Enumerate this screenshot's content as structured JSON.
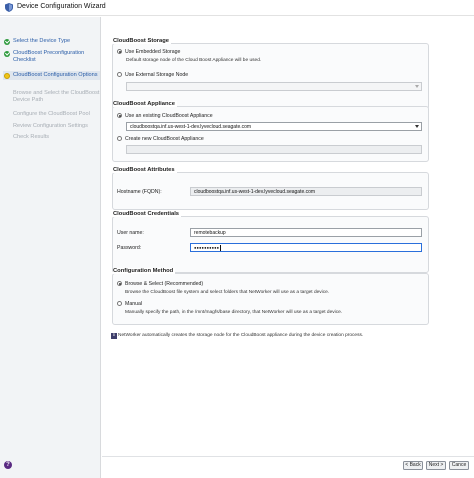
{
  "window": {
    "title": "Device Configuration Wizard"
  },
  "steps": [
    {
      "label": "Select the Device Type",
      "state": "done"
    },
    {
      "label": "CloudBoost Preconfiguration Checklist",
      "state": "done"
    },
    {
      "label": "CloudBoost Configuration Options",
      "state": "current"
    },
    {
      "label": "Browse and Select the CloudBoost Device Path",
      "state": "pending"
    },
    {
      "label": "Configure the CloudBoost Pool",
      "state": "pending"
    },
    {
      "label": "Review Configuration Settings",
      "state": "pending"
    },
    {
      "label": "Check Results",
      "state": "pending"
    }
  ],
  "storage": {
    "title": "CloudBoost Storage",
    "embedded_label": "Use Embedded Storage",
    "embedded_desc": "Default storage node of the Cloud Boost Appliance will be used.",
    "external_label": "Use External Storage Node",
    "external_value": ""
  },
  "appliance": {
    "title": "CloudBoost Appliance",
    "existing_label": "Use an existing CloudBoost Appliance",
    "existing_value": "cloudboostqa.inf.us-west-1-dev.lyvecloud.seagate.com",
    "new_label": "Create new CloudBoost Appliance",
    "new_value": ""
  },
  "attributes": {
    "title": "CloudBoost Attributes",
    "hostname_label": "Hostname (FQDN):",
    "hostname_value": "cloudboostqa.inf.us-west-1-dev.lyvecloud.seagate.com"
  },
  "credentials": {
    "title": "CloudBoost Credentials",
    "username_label": "User name:",
    "username_value": "remotebackup",
    "password_label": "Password:",
    "password_value": "●●●●●●●●●●"
  },
  "method": {
    "title": "Configuration Method",
    "browse_label": "Browse & Select (Recommended)",
    "browse_desc": "Browse the CloudBoost file system and select folders that NetWorker will use as a target device.",
    "manual_label": "Manual",
    "manual_desc": "Manually specify the path, in the /mnt/magfs/base directory, that NetWorker will use as a target device."
  },
  "info": {
    "icon": "info-icon",
    "text": "NetWorker automatically creates the storage node for the CloudBoost appliance during the device creation process."
  },
  "footer": {
    "back_label": "< Back",
    "next_label": "Next >",
    "cancel_label": "Cance"
  },
  "colors": {
    "done": "#2e9b3e",
    "current": "#f0c419",
    "link": "#2a5da8",
    "help": "#5a2a82"
  }
}
